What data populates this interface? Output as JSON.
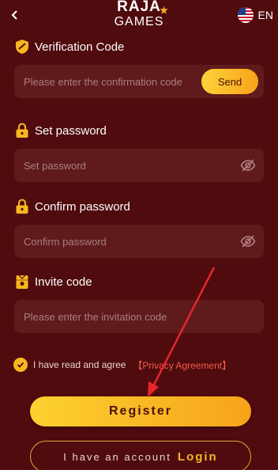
{
  "header": {
    "logo_top": "RAJA",
    "logo_bottom": "GAMES",
    "language": "EN"
  },
  "verification": {
    "label": "Verification Code",
    "placeholder": "Please enter the confirmation code",
    "send_label": "Send"
  },
  "set_password": {
    "label": "Set password",
    "placeholder": "Set password"
  },
  "confirm_password": {
    "label": "Confirm password",
    "placeholder": "Confirm password"
  },
  "invite": {
    "label": "Invite code",
    "placeholder": "Please enter the invitation code"
  },
  "agreement": {
    "text": "I have read and agree",
    "link": "【Privacy Agreement】",
    "checked": true
  },
  "register_label": "Register",
  "login": {
    "prompt": "I have an account",
    "label": "Login"
  },
  "colors": {
    "background": "#4f0b0e",
    "field": "#5f1a1c",
    "accent": "#f9b81f",
    "link": "#f55b4a",
    "annotation_arrow": "#e8262b"
  },
  "icons": [
    "back-arrow-icon",
    "us-flag-icon",
    "shield-icon",
    "lock-icon",
    "eye-off-icon",
    "gift-icon",
    "check-icon"
  ]
}
